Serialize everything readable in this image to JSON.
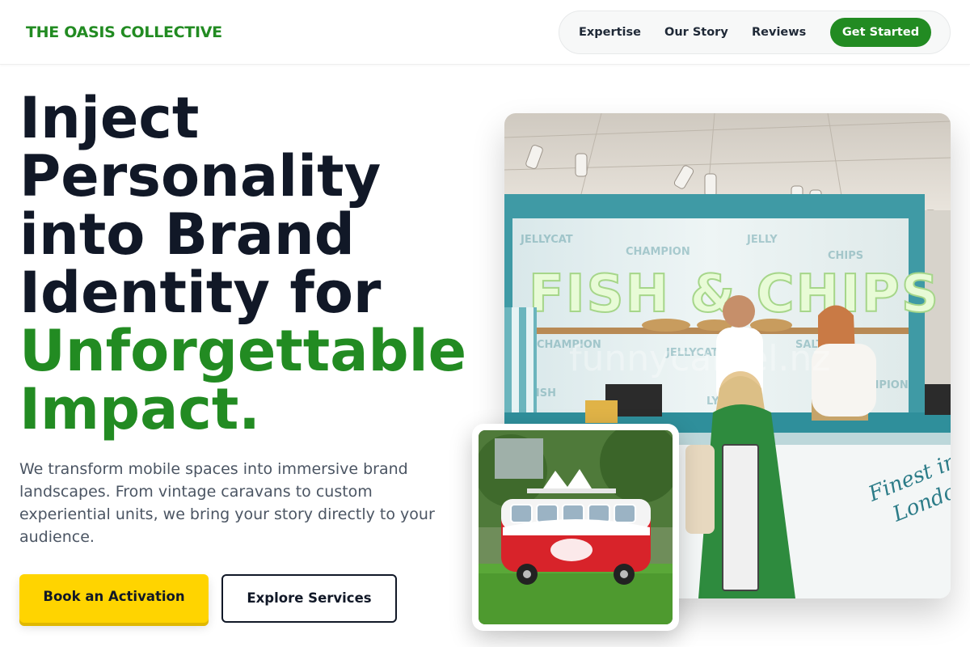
{
  "brand": {
    "name": "THE OASIS COLLECTIVE"
  },
  "nav": {
    "items": [
      {
        "label": "Expertise"
      },
      {
        "label": "Our Story"
      },
      {
        "label": "Reviews"
      }
    ],
    "cta_label": "Get Started"
  },
  "hero": {
    "headline_lines": [
      "Inject",
      "Personality",
      "into Brand",
      "Identity for"
    ],
    "headline_accent_lines": [
      "Unforgettable",
      "Impact."
    ],
    "description": "We transform mobile spaces into immersive brand landscapes. From vintage caravans to custom experiential units, we bring your story directly to your audience.",
    "primary_cta": "Book an Activation",
    "secondary_cta": "Explore Services"
  },
  "images": {
    "main": {
      "sign_text": "FISH & CHIPS",
      "counter_text": "Finest in London",
      "watermark": "funnycamel.nz"
    },
    "inset": {
      "alt": "red-vintage-campervan-photo"
    }
  },
  "colors": {
    "brand_green": "#228b22",
    "cta_yellow": "#ffd400",
    "headline_dark": "#111827",
    "body_gray": "#4b5563"
  }
}
